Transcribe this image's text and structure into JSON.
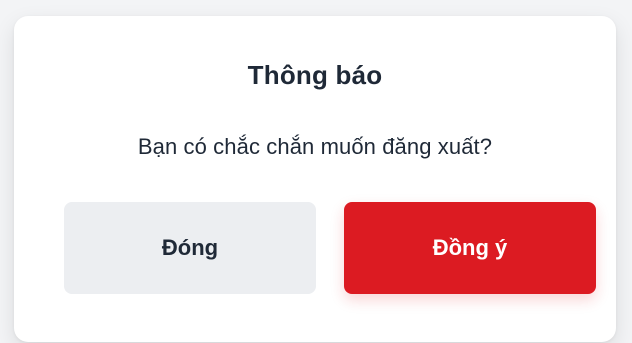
{
  "dialog": {
    "title": "Thông báo",
    "message": "Bạn có chắc chắn muốn đăng xuất?",
    "close_label": "Đóng",
    "confirm_label": "Đồng ý"
  },
  "colors": {
    "background": "#f3f4f6",
    "dialog_bg": "#ffffff",
    "text": "#1f2937",
    "close_button_bg": "#eceef1",
    "confirm_button_bg": "#dc1b22",
    "confirm_button_text": "#ffffff"
  }
}
